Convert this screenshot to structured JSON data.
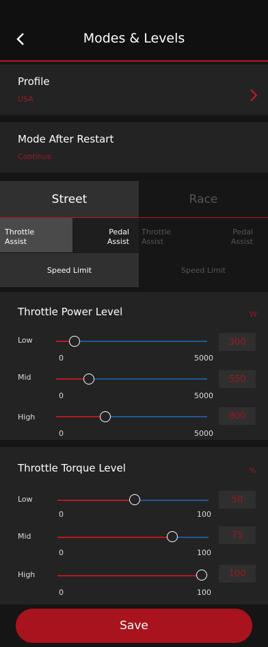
{
  "header": {
    "title": "Modes & Levels",
    "back_icon": "chevron-left-icon"
  },
  "profile": {
    "label": "Profile",
    "value": "USA",
    "chevron_icon": "chevron-right-icon"
  },
  "restart": {
    "label": "Mode After Restart",
    "value": "Continue"
  },
  "tabs": [
    {
      "label": "Street",
      "active": true
    },
    {
      "label": "Race",
      "active": false
    }
  ],
  "subtabs": [
    {
      "label": "Throttle\nAssist",
      "active": true
    },
    {
      "label": "Pedal\nAssist",
      "active": false
    },
    {
      "label": "Throttle\nAssist",
      "active": false
    },
    {
      "label": "Pedal\nAssist",
      "active": false
    }
  ],
  "speed_limits": [
    {
      "label": "Speed Limit",
      "active": true
    },
    {
      "label": "Speed Limit",
      "active": false
    }
  ],
  "power": {
    "title": "Throttle Power Level",
    "unit": "W",
    "rows": [
      {
        "label": "Low",
        "min": "0",
        "max": "5000",
        "value": "300"
      },
      {
        "label": "Mid",
        "min": "0",
        "max": "5000",
        "value": "550"
      },
      {
        "label": "High",
        "min": "0",
        "max": "5000",
        "value": "800"
      }
    ]
  },
  "torque": {
    "title": "Throttle Torque Level",
    "unit": "%",
    "rows": [
      {
        "label": "Low",
        "min": "0",
        "max": "100",
        "value": "50"
      },
      {
        "label": "Mid",
        "min": "0",
        "max": "100",
        "value": "75"
      },
      {
        "label": "High",
        "min": "0",
        "max": "100",
        "value": "100"
      }
    ]
  },
  "save_label": "Save",
  "colors": {
    "accent": "#b51a24",
    "track": "#1e5a92",
    "background": "#151515",
    "card": "#232323"
  }
}
